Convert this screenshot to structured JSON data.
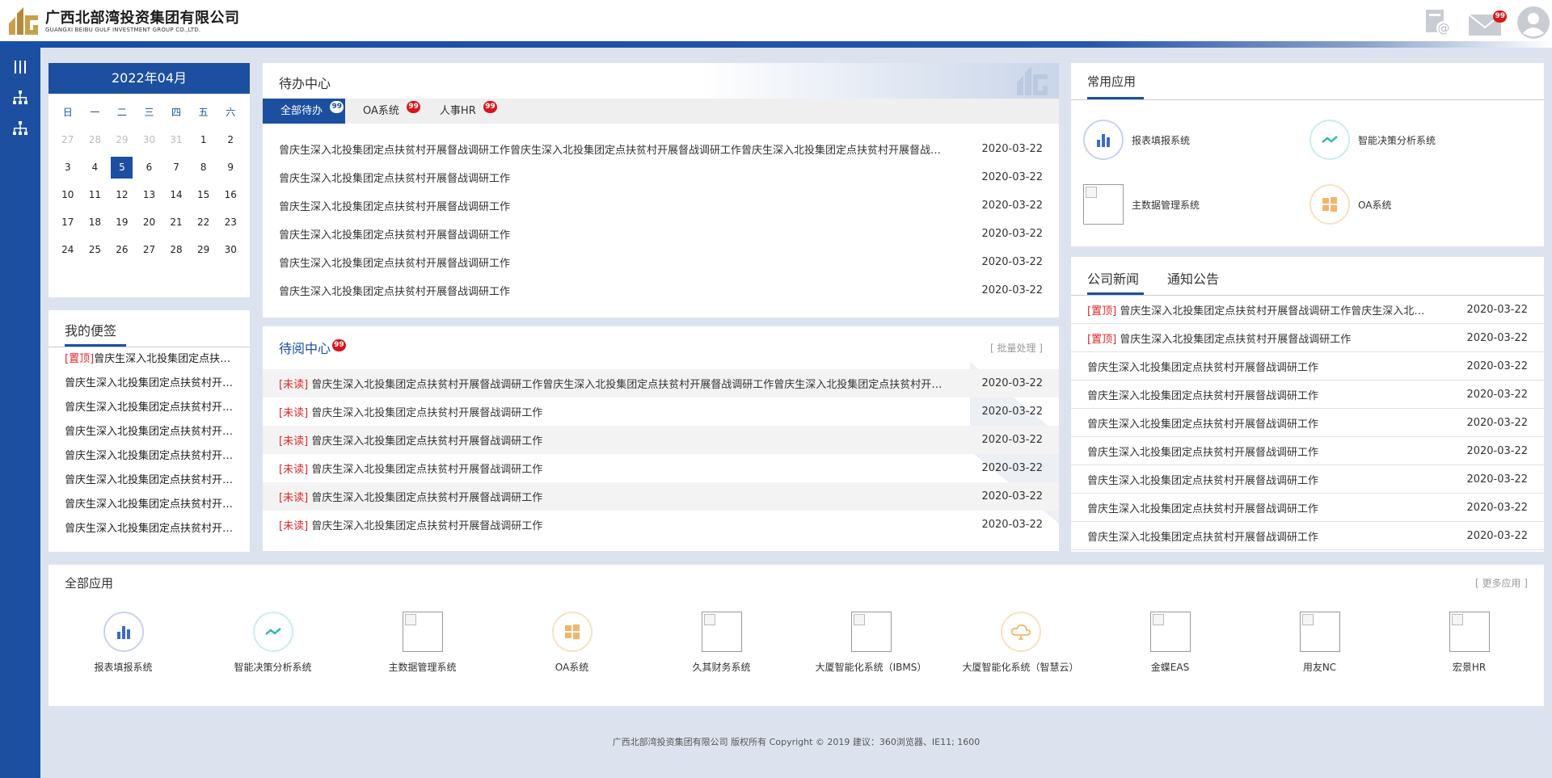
{
  "header": {
    "logo_cn": "广西北部湾投资集团有限公司",
    "logo_en": "GUANGXI BEIBU GULF INVESTMENT GROUP CO.,LTD.",
    "mail_badge": "99",
    "brand_color": "#1c4fa0"
  },
  "sidebar": {
    "items": [
      {
        "icon": "menu-bars-icon"
      },
      {
        "icon": "org-chart-icon"
      },
      {
        "icon": "org-chart-icon"
      }
    ]
  },
  "calendar": {
    "title": "2022年04月",
    "weekdays": [
      "日",
      "一",
      "二",
      "三",
      "四",
      "五",
      "六"
    ],
    "days": [
      {
        "d": "27",
        "dim": true
      },
      {
        "d": "28",
        "dim": true
      },
      {
        "d": "29",
        "dim": true
      },
      {
        "d": "30",
        "dim": true
      },
      {
        "d": "31",
        "dim": true
      },
      {
        "d": "1"
      },
      {
        "d": "2"
      },
      {
        "d": "3"
      },
      {
        "d": "4"
      },
      {
        "d": "5",
        "today": true
      },
      {
        "d": "6"
      },
      {
        "d": "7"
      },
      {
        "d": "8"
      },
      {
        "d": "9"
      },
      {
        "d": "10"
      },
      {
        "d": "11"
      },
      {
        "d": "12"
      },
      {
        "d": "13"
      },
      {
        "d": "14"
      },
      {
        "d": "15"
      },
      {
        "d": "16"
      },
      {
        "d": "17"
      },
      {
        "d": "18"
      },
      {
        "d": "19"
      },
      {
        "d": "20"
      },
      {
        "d": "21"
      },
      {
        "d": "22"
      },
      {
        "d": "23"
      },
      {
        "d": "24"
      },
      {
        "d": "25"
      },
      {
        "d": "26"
      },
      {
        "d": "27"
      },
      {
        "d": "28"
      },
      {
        "d": "29"
      },
      {
        "d": "30"
      }
    ]
  },
  "notes": {
    "title": "我的便签",
    "items": [
      {
        "tag": "[置顶]",
        "text": "曾庆生深入北投集团定点扶贫村开展督战调研工作"
      },
      {
        "tag": "",
        "text": "曾庆生深入北投集团定点扶贫村开展督战调研工作"
      },
      {
        "tag": "",
        "text": "曾庆生深入北投集团定点扶贫村开展督战调研工作"
      },
      {
        "tag": "",
        "text": "曾庆生深入北投集团定点扶贫村开展督战调研工作"
      },
      {
        "tag": "",
        "text": "曾庆生深入北投集团定点扶贫村开展督战调研工作"
      },
      {
        "tag": "",
        "text": "曾庆生深入北投集团定点扶贫村开展督战调研工作"
      },
      {
        "tag": "",
        "text": "曾庆生深入北投集团定点扶贫村开展督战调研工作"
      },
      {
        "tag": "",
        "text": "曾庆生深入北投集团定点扶贫村开展督战调研工作"
      }
    ]
  },
  "todo": {
    "title": "待办中心",
    "tabs": [
      {
        "label": "全部待办",
        "badge": "99"
      },
      {
        "label": "OA系统",
        "badge": "99"
      },
      {
        "label": "人事HR",
        "badge": "99"
      }
    ],
    "rows": [
      {
        "text": "曾庆生深入北投集团定点扶贫村开展督战调研工作曾庆生深入北投集团定点扶贫村开展督战调研工作曾庆生深入北投集团定点扶贫村开展督战调研工作",
        "date": "2020-03-22"
      },
      {
        "text": "曾庆生深入北投集团定点扶贫村开展督战调研工作",
        "date": "2020-03-22"
      },
      {
        "text": "曾庆生深入北投集团定点扶贫村开展督战调研工作",
        "date": "2020-03-22"
      },
      {
        "text": "曾庆生深入北投集团定点扶贫村开展督战调研工作",
        "date": "2020-03-22"
      },
      {
        "text": "曾庆生深入北投集团定点扶贫村开展督战调研工作",
        "date": "2020-03-22"
      },
      {
        "text": "曾庆生深入北投集团定点扶贫村开展督战调研工作",
        "date": "2020-03-22"
      }
    ]
  },
  "toread": {
    "title": "待阅中心",
    "badge": "99",
    "batch": "[ 批量处理 ]",
    "rows": [
      {
        "tag": "[未读]",
        "text": "曾庆生深入北投集团定点扶贫村开展督战调研工作曾庆生深入北投集团定点扶贫村开展督战调研工作曾庆生深入北投集团定点扶贫村开展督战调研工作",
        "date": "2020-03-22"
      },
      {
        "tag": "[未读]",
        "text": "曾庆生深入北投集团定点扶贫村开展督战调研工作",
        "date": "2020-03-22"
      },
      {
        "tag": "[未读]",
        "text": "曾庆生深入北投集团定点扶贫村开展督战调研工作",
        "date": "2020-03-22"
      },
      {
        "tag": "[未读]",
        "text": "曾庆生深入北投集团定点扶贫村开展督战调研工作",
        "date": "2020-03-22"
      },
      {
        "tag": "[未读]",
        "text": "曾庆生深入北投集团定点扶贫村开展督战调研工作",
        "date": "2020-03-22"
      },
      {
        "tag": "[未读]",
        "text": "曾庆生深入北投集团定点扶贫村开展督战调研工作",
        "date": "2020-03-22"
      }
    ]
  },
  "common_apps": {
    "title": "常用应用",
    "items": [
      {
        "label": "报表填报系统",
        "icon": "bar-chart-icon"
      },
      {
        "label": "智能决策分析系统",
        "icon": "trend-line-icon"
      },
      {
        "label": "主数据管理系统",
        "icon": "broken-image-icon"
      },
      {
        "label": "OA系统",
        "icon": "windows-icon"
      }
    ]
  },
  "news": {
    "tabs": [
      "公司新闻",
      "通知公告"
    ],
    "rows": [
      {
        "tag": "[置顶]",
        "text": "曾庆生深入北投集团定点扶贫村开展督战调研工作曾庆生深入北投集团定点扶贫村开展督战调研工作",
        "date": "2020-03-22"
      },
      {
        "tag": "[置顶]",
        "text": "曾庆生深入北投集团定点扶贫村开展督战调研工作",
        "date": "2020-03-22"
      },
      {
        "tag": "",
        "text": "曾庆生深入北投集团定点扶贫村开展督战调研工作",
        "date": "2020-03-22"
      },
      {
        "tag": "",
        "text": "曾庆生深入北投集团定点扶贫村开展督战调研工作",
        "date": "2020-03-22"
      },
      {
        "tag": "",
        "text": "曾庆生深入北投集团定点扶贫村开展督战调研工作",
        "date": "2020-03-22"
      },
      {
        "tag": "",
        "text": "曾庆生深入北投集团定点扶贫村开展督战调研工作",
        "date": "2020-03-22"
      },
      {
        "tag": "",
        "text": "曾庆生深入北投集团定点扶贫村开展督战调研工作",
        "date": "2020-03-22"
      },
      {
        "tag": "",
        "text": "曾庆生深入北投集团定点扶贫村开展督战调研工作",
        "date": "2020-03-22"
      },
      {
        "tag": "",
        "text": "曾庆生深入北投集团定点扶贫村开展督战调研工作",
        "date": "2020-03-22"
      }
    ]
  },
  "all_apps": {
    "title": "全部应用",
    "more": "[ 更多应用 ]",
    "items": [
      {
        "label": "报表填报系统",
        "icon": "bar-chart-icon"
      },
      {
        "label": "智能决策分析系统",
        "icon": "trend-line-icon"
      },
      {
        "label": "主数据管理系统",
        "icon": "broken-image-icon"
      },
      {
        "label": "OA系统",
        "icon": "windows-icon"
      },
      {
        "label": "久其财务系统",
        "icon": "broken-image-icon"
      },
      {
        "label": "大厦智能化系统（IBMS）",
        "icon": "broken-image-icon"
      },
      {
        "label": "大厦智能化系统（智慧云）",
        "icon": "cloud-icon"
      },
      {
        "label": "金蝶EAS",
        "icon": "broken-image-icon"
      },
      {
        "label": "用友NC",
        "icon": "broken-image-icon"
      },
      {
        "label": "宏景HR",
        "icon": "broken-image-icon"
      }
    ]
  },
  "footer": {
    "text": "广西北部湾投资集团有限公司 版权所有 Copyright © 2019 建议：360浏览器、IE11; 1600"
  }
}
